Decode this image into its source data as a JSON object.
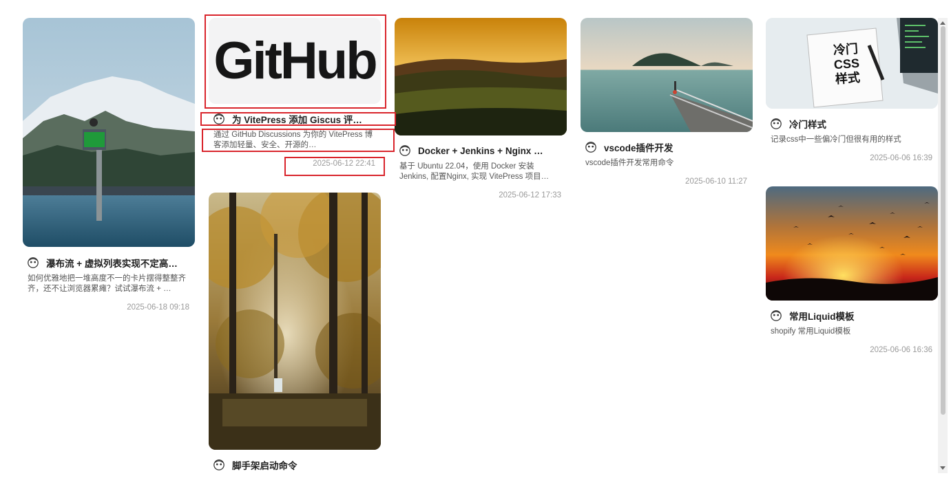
{
  "posts": [
    {
      "title": "瀑布流 + 虚拟列表实现不定高…",
      "desc": "如何优雅地把一堆高度不一的卡片摆得整整齐齐，还不让浏览器累瘫？试试瀑布流 + …",
      "date": "2025-06-18 09:18",
      "image": "mountain-lake-buoy"
    },
    {
      "title": "为 VitePress 添加 Giscus 评…",
      "desc": "通过 GitHub Discussions 为你的 VitePress 博客添加轻量、安全、开源的…",
      "date": "2025-06-12 22:41",
      "image": "github-logo",
      "logo_text": "GitHub"
    },
    {
      "title": "脚手架启动命令",
      "desc": "",
      "date": "",
      "image": "autumn-forest-waterfall"
    },
    {
      "title": "Docker + Jenkins + Nginx …",
      "desc": "基于 Ubuntu 22.04，使用 Docker 安装 Jenkins, 配置Nginx, 实现 VitePress 项目…",
      "date": "2025-06-12 17:33",
      "image": "sunset-fields"
    },
    {
      "title": "vscode插件开发",
      "desc": "vscode插件开发常用命令",
      "date": "2025-06-10 11:27",
      "image": "sea-pier-island"
    },
    {
      "title": "冷门样式",
      "desc": "记录css中一些偏冷门但很有用的样式",
      "date": "2025-06-06 16:39",
      "image": "notebook-laptop",
      "note_text": [
        "冷门",
        "CSS",
        "样式"
      ]
    },
    {
      "title": "常用Liquid模板",
      "desc": "shopify 常用Liquid模板",
      "date": "2025-06-06 16:36",
      "image": "sunset-birds"
    }
  ],
  "colors": {
    "highlight": "#d9242b",
    "title": "#1f1f1f",
    "date": "#9a9a9a"
  },
  "icons": {
    "avatar": "avatar-icon"
  }
}
